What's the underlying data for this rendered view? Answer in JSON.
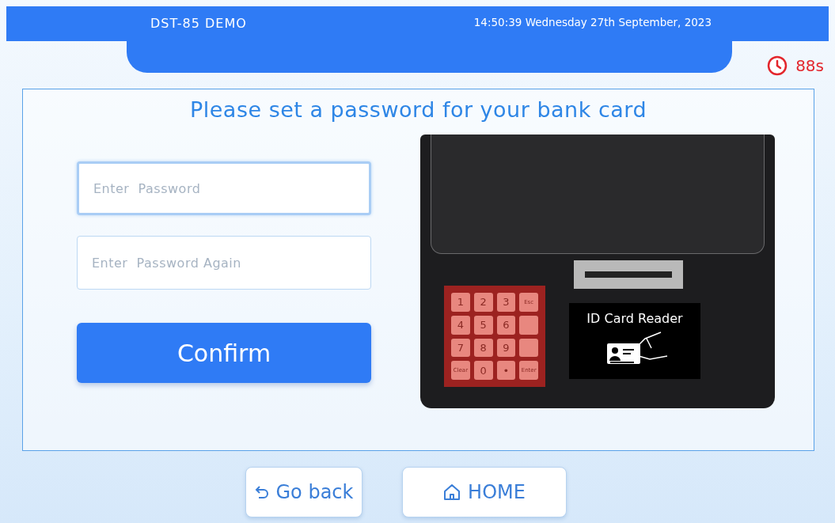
{
  "header": {
    "title": "DST-85 DEMO",
    "datetime": "14:50:39 Wednesday 27th September, 2023"
  },
  "timer": {
    "text": "88s"
  },
  "main": {
    "title": "Please set a password for your bank card",
    "fields": [
      {
        "placeholder": "Enter  Password",
        "focused": true
      },
      {
        "placeholder": "Enter  Password Again",
        "focused": false
      }
    ],
    "confirm": "Confirm",
    "device": {
      "keys": [
        {
          "kind": "digit",
          "label": "1"
        },
        {
          "kind": "digit",
          "label": "2"
        },
        {
          "kind": "digit",
          "label": "3"
        },
        {
          "kind": "func",
          "label": "Esc"
        },
        {
          "kind": "digit",
          "label": "4"
        },
        {
          "kind": "digit",
          "label": "5"
        },
        {
          "kind": "digit",
          "label": "6"
        },
        {
          "kind": "blank"
        },
        {
          "kind": "digit",
          "label": "7"
        },
        {
          "kind": "digit",
          "label": "8"
        },
        {
          "kind": "digit",
          "label": "9"
        },
        {
          "kind": "blank"
        },
        {
          "kind": "func",
          "label": "Clear"
        },
        {
          "kind": "digit",
          "label": "0"
        },
        {
          "kind": "digit",
          "label": "•"
        },
        {
          "kind": "func",
          "label": "Enter"
        }
      ],
      "reader_label": "ID Card Reader"
    }
  },
  "footer": {
    "buttons": [
      {
        "kind": "back",
        "label": "Go back"
      },
      {
        "kind": "home",
        "label": "HOME"
      }
    ]
  }
}
